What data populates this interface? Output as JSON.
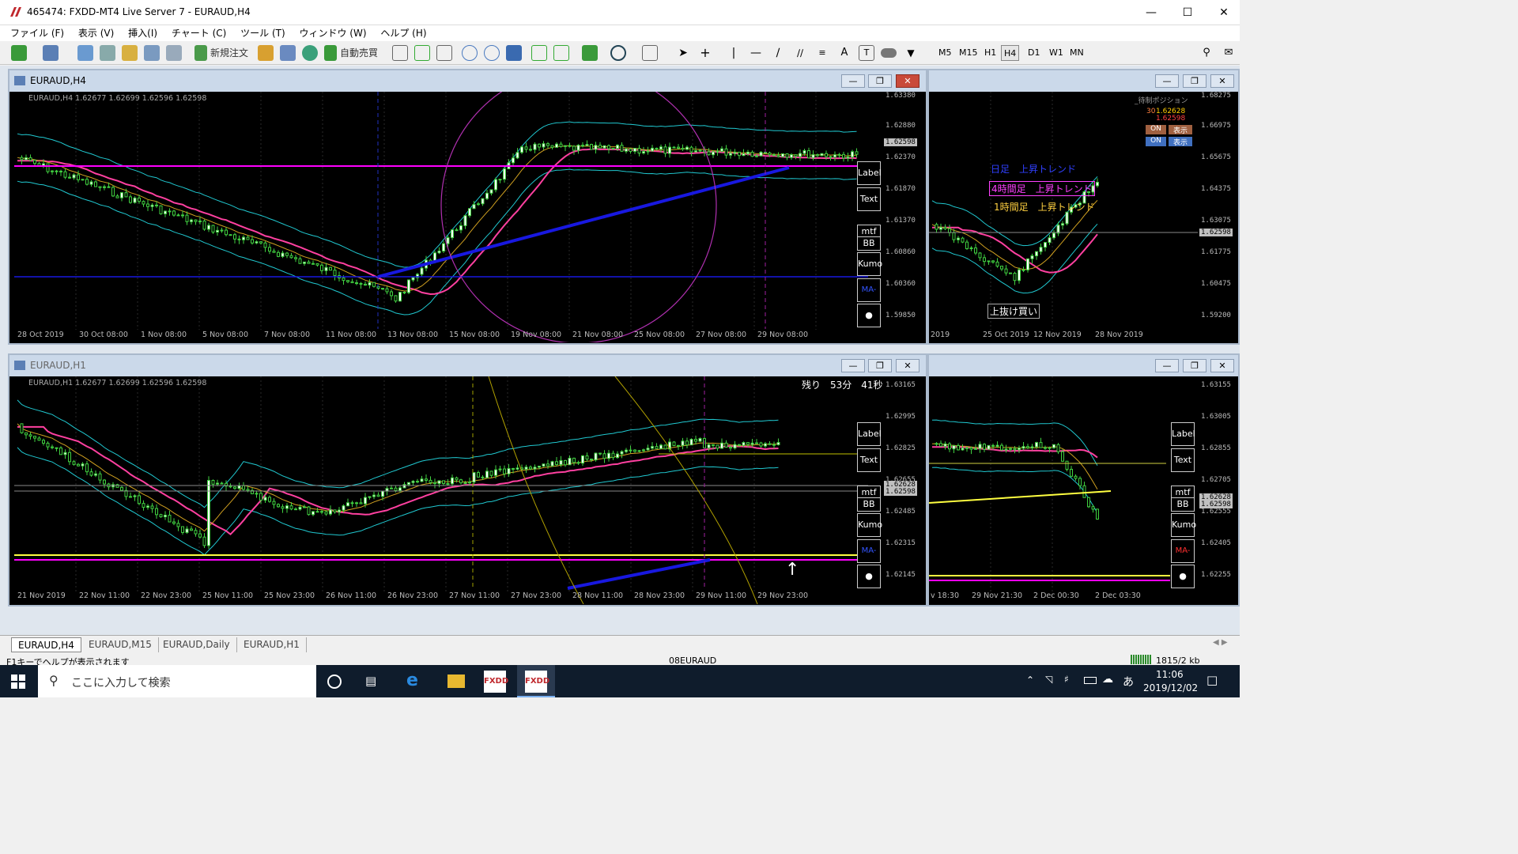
{
  "window": {
    "title": "465474: FXDD-MT4 Live Server 7 - EURAUD,H4"
  },
  "menu": [
    "ファイル (F)",
    "表示 (V)",
    "挿入(I)",
    "チャート (C)",
    "ツール (T)",
    "ウィンドウ (W)",
    "ヘルプ (H)"
  ],
  "toolbar": {
    "new_order": "新規注文",
    "auto_trade": "自動売買",
    "timeframes": [
      "M5",
      "M15",
      "H1",
      "H4",
      "D1",
      "W1",
      "MN"
    ],
    "active_timeframe": "H4"
  },
  "chart_h4": {
    "title": "EURAUD,H4",
    "info": "EURAUD,H4  1.62677 1.62699 1.62596 1.62598",
    "current_price": "1.62598",
    "y_ticks": [
      "1.63380",
      "1.62880",
      "1.62370",
      "1.61870",
      "1.61370",
      "1.60860",
      "1.60360",
      "1.59850"
    ],
    "x_ticks": [
      "28 Oct 2019",
      "30 Oct 08:00",
      "1 Nov 08:00",
      "5 Nov 08:00",
      "7 Nov 08:00",
      "11 Nov 08:00",
      "13 Nov 08:00",
      "15 Nov 08:00",
      "19 Nov 08:00",
      "21 Nov 08:00",
      "25 Nov 08:00",
      "27 Nov 08:00",
      "29 Nov 08:00"
    ],
    "side_buttons": [
      "Label",
      "Text",
      "mtf",
      "BB",
      "Kumo",
      "MA-Cl"
    ]
  },
  "chart_d1": {
    "y_ticks": [
      "1.68275",
      "1.66975",
      "1.65675",
      "1.64375",
      "1.63075",
      "1.61775",
      "1.60475",
      "1.59200"
    ],
    "x_ticks": [
      "2019",
      "25 Oct 2019",
      "12 Nov 2019",
      "28 Nov 2019"
    ],
    "current_price": "1.62598",
    "position_title": "_待制ポジション",
    "price_up": "1.62628",
    "price_down": "1.62598",
    "price_prefix": "30",
    "on_label": "ON",
    "show_label": "表示",
    "trend_daily": "日足　上昇トレンド",
    "trend_4h": "4時間足　上昇トレンド",
    "trend_1h": "1時間足　上昇トレンド",
    "buy_label": "上抜け買い"
  },
  "chart_h1": {
    "title": "EURAUD,H1",
    "info": "EURAUD,H1  1.62677 1.62699 1.62596 1.62598",
    "remaining": "残り　53分　41秒",
    "price_a": "1.62628",
    "price_b": "1.62598",
    "y_ticks": [
      "1.63165",
      "1.62995",
      "1.62825",
      "1.62655",
      "1.62485",
      "1.62315",
      "1.62145"
    ],
    "x_ticks": [
      "21 Nov 2019",
      "22 Nov 11:00",
      "22 Nov 23:00",
      "25 Nov 11:00",
      "25 Nov 23:00",
      "26 Nov 11:00",
      "26 Nov 23:00",
      "27 Nov 11:00",
      "27 Nov 23:00",
      "28 Nov 11:00",
      "28 Nov 23:00",
      "29 Nov 11:00",
      "29 Nov 23:00"
    ],
    "side_buttons": [
      "Label",
      "Text",
      "mtf",
      "BB",
      "Kumo",
      "MA-Cl"
    ]
  },
  "chart_m15": {
    "y_ticks": [
      "1.63155",
      "1.63005",
      "1.62855",
      "1.62705",
      "1.62555",
      "1.62405",
      "1.62255"
    ],
    "x_ticks": [
      "v 18:30",
      "29 Nov 21:30",
      "2 Dec 00:30",
      "2 Dec 03:30"
    ],
    "price_a": "1.62628",
    "price_b": "1.62598",
    "side_buttons": [
      "Label",
      "Text",
      "mtf",
      "BB",
      "Kumo",
      "MA-Cl"
    ]
  },
  "tabs": [
    "EURAUD,H4",
    "EURAUD,M15",
    "EURAUD,Daily",
    "EURAUD,H1"
  ],
  "status": {
    "help": "F1キーでヘルプが表示されます",
    "profile": "08EURAUD",
    "traffic": "1815/2 kb"
  },
  "taskbar": {
    "search": "ここに入力して検索",
    "time": "11:06",
    "date": "2019/12/02",
    "ime": "あ"
  },
  "colors": {
    "bb": "#20c8d0",
    "ma_pink": "#ff40a0",
    "trend_blue": "#1818e0",
    "magenta": "#ff00ff",
    "yellow": "#ffff40"
  }
}
